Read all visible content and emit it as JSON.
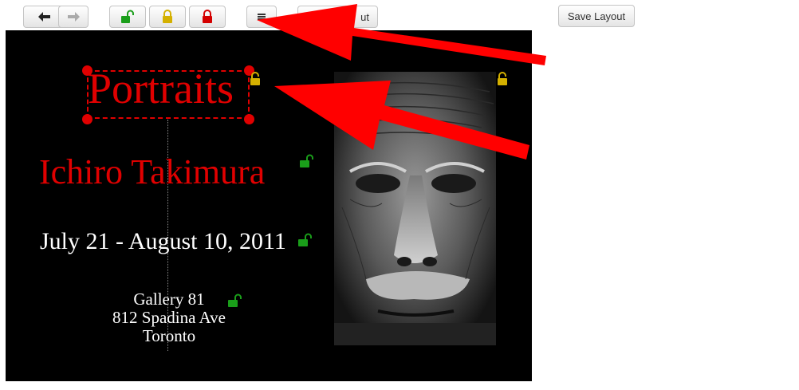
{
  "toolbar": {
    "back_icon": "arrow-left-icon",
    "forward_icon": "arrow-right-icon",
    "lock_open_icon": "lock-open-icon",
    "lock_partial_icon": "lock-icon",
    "lock_closed_icon": "lock-icon",
    "menu_icon": "menu-icon",
    "partial_button_label": "ut",
    "save_label": "Save Layout"
  },
  "poster": {
    "title": "Portraits",
    "artist": "Ichiro Takimura",
    "dates": "July 21 - August 10, 2011",
    "venue_line1": "Gallery 81",
    "venue_line2": "812 Spadina Ave",
    "venue_line3": "Toronto",
    "photo_subject": "close-up black and white portrait of an elderly man"
  },
  "colors": {
    "lock_open": "#1a9e1a",
    "lock_partial": "#d4b000",
    "lock_closed": "#d40000",
    "accent_red": "#e00000",
    "canvas": "#000000"
  }
}
